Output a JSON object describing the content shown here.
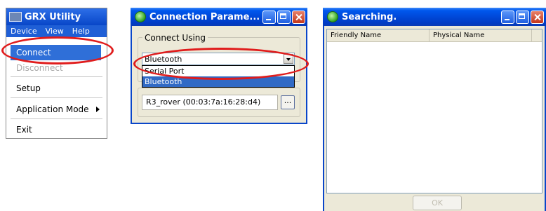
{
  "grx_window": {
    "title": "GRX Utility",
    "menubar": [
      "Device",
      "View",
      "Help"
    ],
    "menu_items": {
      "connect": "Connect",
      "disconnect": "Disconnect",
      "setup": "Setup",
      "application_mode": "Application Mode",
      "exit": "Exit"
    }
  },
  "connection_window": {
    "title": "Connection Parame...",
    "group_label": "Connect Using",
    "selected_value": "Bluetooth",
    "dropdown_options": [
      "Serial Port",
      "Bluetooth"
    ],
    "device_value": "R3_rover (00:03:7a:16:28:d4)",
    "browse_label": "..."
  },
  "searching_window": {
    "title": "Searching.",
    "columns": [
      "Friendly Name",
      "Physical Name"
    ],
    "ok_label": "OK"
  },
  "colors": {
    "title_bar_blue": "#0046d5",
    "highlight_oval": "#e01c1c",
    "selection_blue": "#316ac5"
  }
}
